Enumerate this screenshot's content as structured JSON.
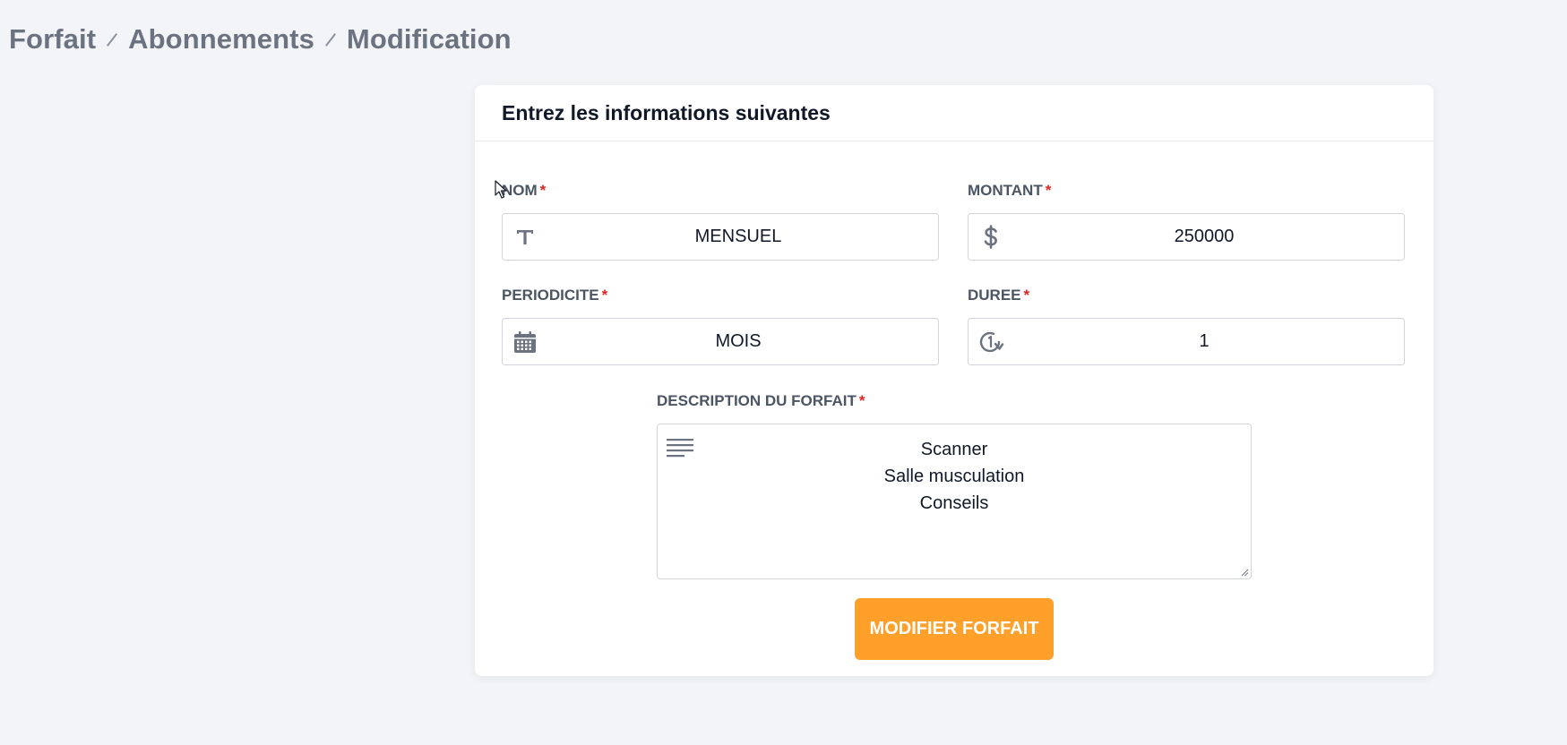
{
  "breadcrumb": {
    "items": [
      "Forfait",
      "Abonnements",
      "Modification"
    ]
  },
  "card": {
    "title": "Entrez les informations suivantes"
  },
  "form": {
    "nom": {
      "label": "NOM",
      "required_mark": "*",
      "value": "MENSUEL",
      "icon": "text-type-icon"
    },
    "montant": {
      "label": "MONTANT",
      "required_mark": "*",
      "value": "250000",
      "icon": "dollar-icon"
    },
    "periodicite": {
      "label": "PERIODICITE",
      "required_mark": "*",
      "value": "MOIS",
      "icon": "calendar-icon"
    },
    "duree": {
      "label": "DUREE",
      "required_mark": "*",
      "value": "1",
      "icon": "clock-rotate-icon"
    },
    "description": {
      "label": "DESCRIPTION DU FORFAIT",
      "required_mark": "*",
      "lines": [
        "Scanner",
        "Salle musculation",
        "Conseils"
      ],
      "icon": "paragraph-align-icon"
    },
    "submit_label": "MODIFIER FORFAIT"
  },
  "colors": {
    "page_bg": "#f3f4f8",
    "card_bg": "#ffffff",
    "accent": "#ffa02b",
    "required": "#dc2626",
    "label": "#4b5563",
    "icon": "#6b7280"
  }
}
